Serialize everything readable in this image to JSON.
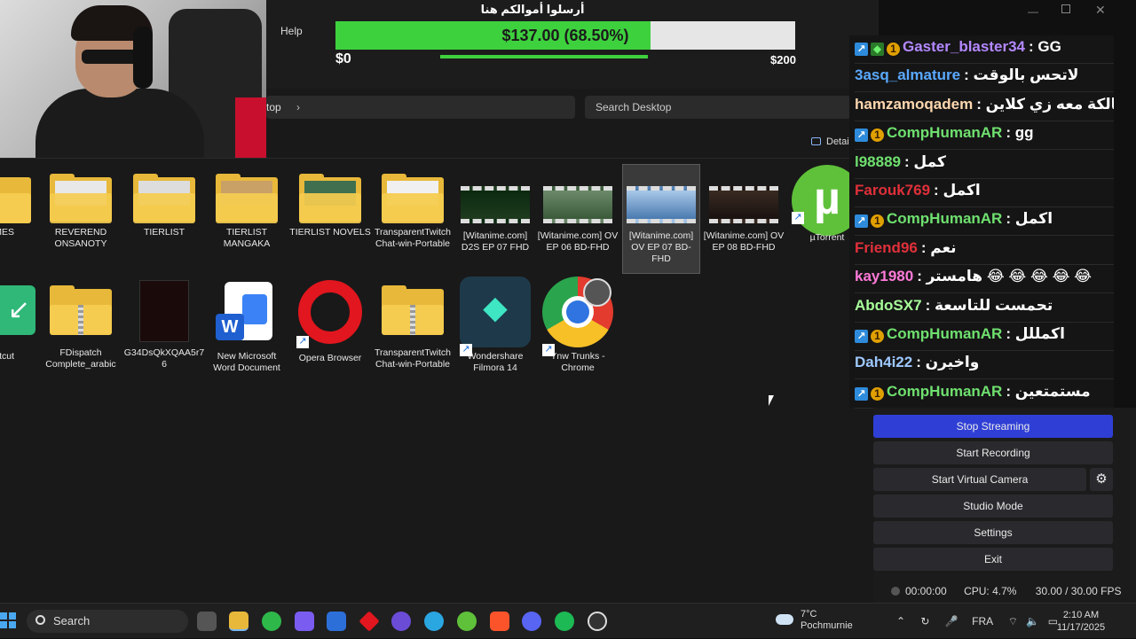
{
  "explorer": {
    "menu_help": "Help",
    "address_crumb": "top",
    "search_placeholder": "Search Desktop",
    "details_label": "Details",
    "files_row1": [
      {
        "label": "MES",
        "kind": "folder"
      },
      {
        "label": "REVEREND ONSANOTY",
        "kind": "folder"
      },
      {
        "label": "TIERLIST",
        "kind": "folder"
      },
      {
        "label": "TIERLIST MANGAKA",
        "kind": "folder"
      },
      {
        "label": "TIERLIST NOVELS",
        "kind": "folder"
      },
      {
        "label": "TransparentTwitchChat-win-Portable",
        "kind": "folder"
      },
      {
        "label": "[Witanime.com] D2S EP 07 FHD",
        "kind": "video"
      },
      {
        "label": "[Witanime.com] OV EP 06 BD-FHD",
        "kind": "video"
      },
      {
        "label": "[Witanime.com] OV EP 07 BD-FHD",
        "kind": "video"
      },
      {
        "label": "[Witanime.com] OV EP 08 BD-FHD",
        "kind": "video"
      },
      {
        "label": "µTorrent",
        "kind": "app"
      }
    ],
    "files_row2": [
      {
        "label": "oads - tcut",
        "kind": "shortcut"
      },
      {
        "label": "FDispatch Complete_arabic",
        "kind": "zip"
      },
      {
        "label": "G34DsQkXQAA5r76",
        "kind": "image"
      },
      {
        "label": "New Microsoft Word Document",
        "kind": "word"
      },
      {
        "label": "Opera Browser",
        "kind": "opera"
      },
      {
        "label": "TransparentTwitchChat-win-Portable",
        "kind": "zip"
      },
      {
        "label": "Wondershare Filmora 14",
        "kind": "filmora"
      },
      {
        "label": "Ynw Trunks - Chrome",
        "kind": "chrome"
      }
    ]
  },
  "donation": {
    "title": "أرسلوا أموالكم هنا",
    "amount": "$137.00 (68.50%)",
    "progress": 0.685,
    "min_label": "$0",
    "max_label": "$200"
  },
  "chat": {
    "messages": [
      {
        "user": "Gaster_blaster34",
        "text": "GG",
        "color": "#b388ff",
        "badges": [
          "prime",
          "gem",
          "one"
        ]
      },
      {
        "user": "3asq_almature",
        "text": "لاتحس بالوقت",
        "color": "#5aa9ff",
        "badges": []
      },
      {
        "user": "hamzamoqadem",
        "text": "سالكة معه زي كلاين",
        "color": "#ffd8b0",
        "badges": []
      },
      {
        "user": "CompHumanAR",
        "text": "gg",
        "color": "#6fe06f",
        "badges": [
          "prime",
          "one"
        ]
      },
      {
        "user": "l98889",
        "text": "كمل",
        "color": "#6fe06f",
        "badges": []
      },
      {
        "user": "Farouk769",
        "text": "اكمل",
        "color": "#e0303a",
        "badges": []
      },
      {
        "user": "CompHumanAR",
        "text": "اكمل",
        "color": "#6fe06f",
        "badges": [
          "prime",
          "one"
        ]
      },
      {
        "user": "Friend96",
        "text": "نعم",
        "color": "#e0303a",
        "badges": []
      },
      {
        "user": "kay1980",
        "text": "هامستر 😂 😂 😂 😂 😂",
        "color": "#ff7ad9",
        "badges": []
      },
      {
        "user": "AbdoSX7",
        "text": "تحمست للتاسعة",
        "color": "#a8ff9a",
        "badges": []
      },
      {
        "user": "CompHumanAR",
        "text": "اكمللل",
        "color": "#6fe06f",
        "badges": [
          "prime",
          "one"
        ]
      },
      {
        "user": "Dah4i22",
        "text": "واخيرن",
        "color": "#9ec8ff",
        "badges": []
      },
      {
        "user": "CompHumanAR",
        "text": "مستمتعين",
        "color": "#6fe06f",
        "badges": [
          "prime",
          "one"
        ]
      }
    ]
  },
  "obs": {
    "stop_streaming": "Stop Streaming",
    "start_recording": "Start Recording",
    "start_virtual_camera": "Start Virtual Camera",
    "studio_mode": "Studio Mode",
    "settings": "Settings",
    "exit": "Exit",
    "status_time": "00:00:00",
    "cpu": "CPU: 4.7%",
    "fps": "30.00 / 30.00 FPS"
  },
  "taskbar": {
    "search_label": "Search",
    "weather_temp": "7°C",
    "weather_place": "Pochmurnie",
    "language": "FRA",
    "time": "2:10 AM",
    "date": "11/17/2025"
  }
}
